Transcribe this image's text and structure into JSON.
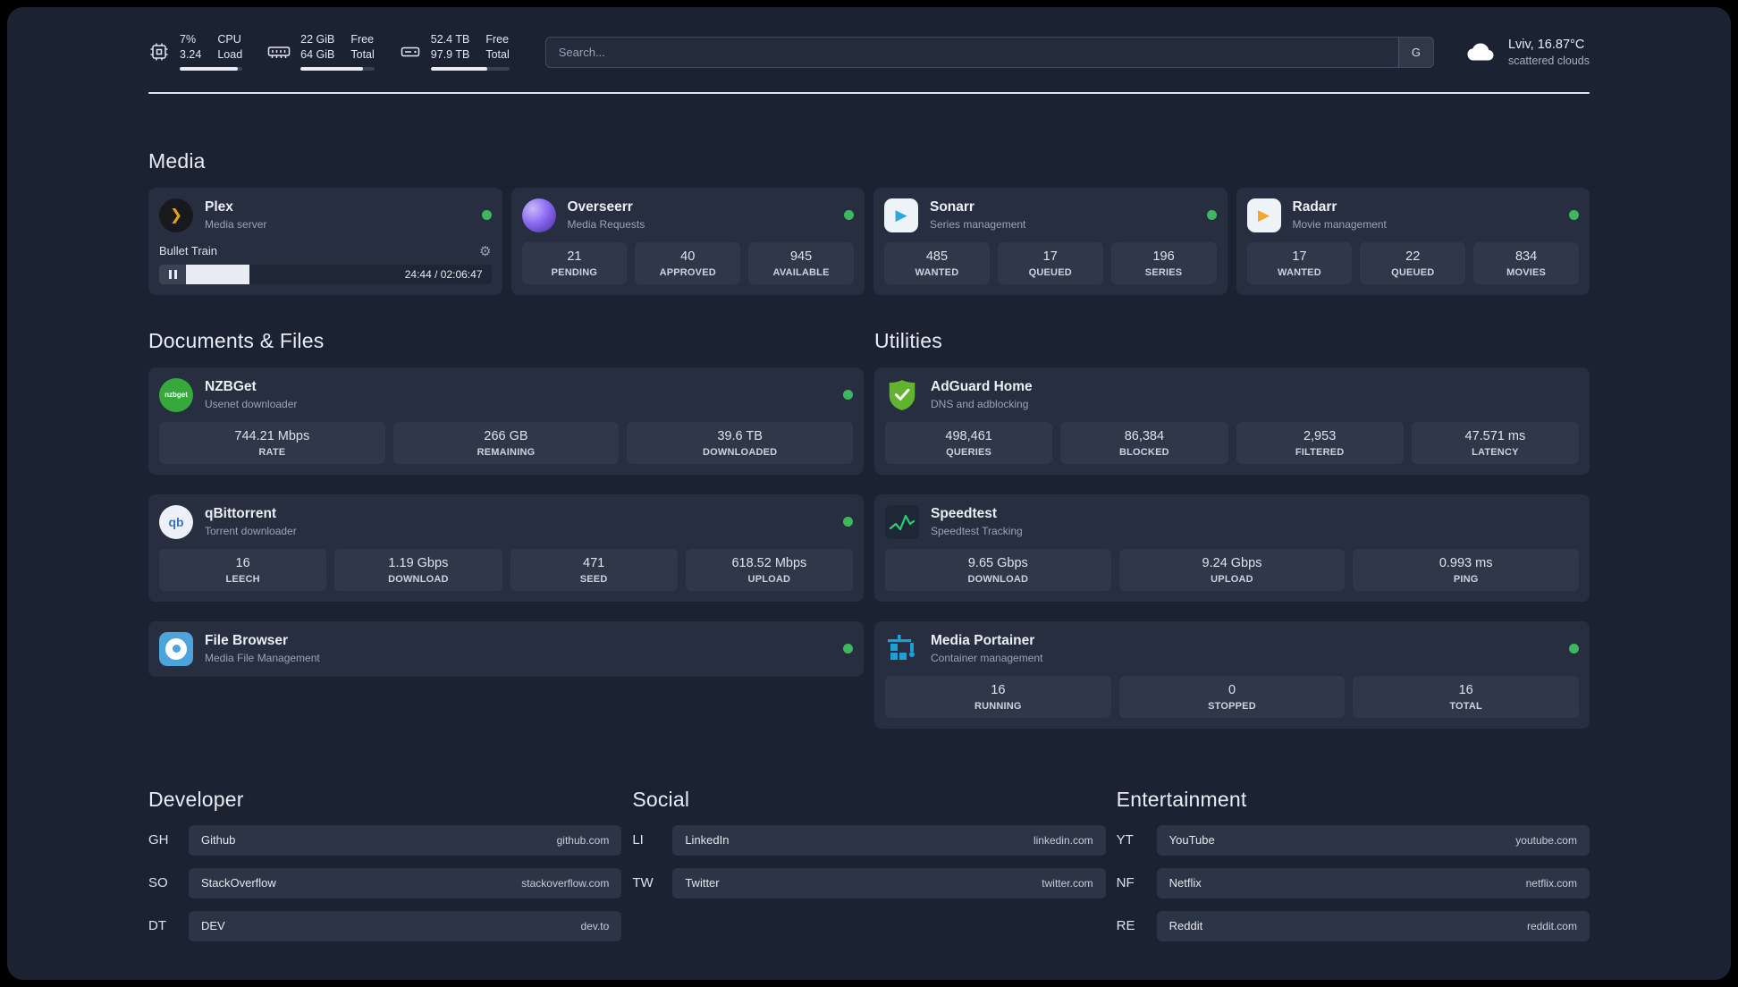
{
  "colors": {
    "status_online": "#3fb75f",
    "plex": "#e5a00d",
    "overseerr": "#8b6cf0",
    "sonarr": "#2da8de",
    "radarr": "#f0a72b",
    "nzbget": "#37a93c",
    "qbittorrent": "#3a74b8",
    "filebrowser": "#4da3dc",
    "adguard": "#62b42f",
    "speedtest": "#2ecc71",
    "portainer": "#1e9fd8"
  },
  "icons": {
    "nzbget_text": "nzbget",
    "qbittorrent_text": "qb"
  },
  "topbar": {
    "cpu": {
      "value_top": "7%",
      "value_bottom": "3.24",
      "label_top": "CPU",
      "label_bottom": "Load",
      "bar_percent": 93
    },
    "ram": {
      "value_top": "22 GiB",
      "value_bottom": "64 GiB",
      "label_top": "Free",
      "label_bottom": "Total",
      "bar_percent": 85
    },
    "disk": {
      "value_top": "52.4 TB",
      "value_bottom": "97.9 TB",
      "label_top": "Free",
      "label_bottom": "Total",
      "bar_percent": 72
    },
    "search": {
      "placeholder": "Search...",
      "engine_button": "G"
    },
    "weather": {
      "location": "Lviv, 16.87°C",
      "condition": "scattered clouds"
    }
  },
  "media": {
    "title": "Media",
    "cards": [
      {
        "name": "Plex",
        "subtitle": "Media server",
        "status": "online",
        "player": {
          "track": "Bullet Train",
          "time": "24:44 / 02:06:47",
          "progress_percent": 19
        }
      },
      {
        "name": "Overseerr",
        "subtitle": "Media Requests",
        "status": "online",
        "stats": [
          {
            "value": "21",
            "label": "PENDING"
          },
          {
            "value": "40",
            "label": "APPROVED"
          },
          {
            "value": "945",
            "label": "AVAILABLE"
          }
        ]
      },
      {
        "name": "Sonarr",
        "subtitle": "Series management",
        "status": "online",
        "stats": [
          {
            "value": "485",
            "label": "WANTED"
          },
          {
            "value": "17",
            "label": "QUEUED"
          },
          {
            "value": "196",
            "label": "SERIES"
          }
        ]
      },
      {
        "name": "Radarr",
        "subtitle": "Movie management",
        "status": "online",
        "stats": [
          {
            "value": "17",
            "label": "WANTED"
          },
          {
            "value": "22",
            "label": "QUEUED"
          },
          {
            "value": "834",
            "label": "MOVIES"
          }
        ]
      }
    ]
  },
  "documents": {
    "title": "Documents & Files",
    "cards": [
      {
        "name": "NZBGet",
        "subtitle": "Usenet downloader",
        "status": "online",
        "stats": [
          {
            "value": "744.21 Mbps",
            "label": "RATE"
          },
          {
            "value": "266 GB",
            "label": "REMAINING"
          },
          {
            "value": "39.6 TB",
            "label": "DOWNLOADED"
          }
        ]
      },
      {
        "name": "qBittorrent",
        "subtitle": "Torrent downloader",
        "status": "online",
        "stats": [
          {
            "value": "16",
            "label": "LEECH"
          },
          {
            "value": "1.19 Gbps",
            "label": "DOWNLOAD"
          },
          {
            "value": "471",
            "label": "SEED"
          },
          {
            "value": "618.52 Mbps",
            "label": "UPLOAD"
          }
        ]
      },
      {
        "name": "File Browser",
        "subtitle": "Media File Management",
        "status": "online",
        "stats": []
      }
    ]
  },
  "utilities": {
    "title": "Utilities",
    "cards": [
      {
        "name": "AdGuard Home",
        "subtitle": "DNS and adblocking",
        "stats": [
          {
            "value": "498,461",
            "label": "QUERIES"
          },
          {
            "value": "86,384",
            "label": "BLOCKED"
          },
          {
            "value": "2,953",
            "label": "FILTERED"
          },
          {
            "value": "47.571 ms",
            "label": "LATENCY"
          }
        ]
      },
      {
        "name": "Speedtest",
        "subtitle": "Speedtest Tracking",
        "stats": [
          {
            "value": "9.65 Gbps",
            "label": "DOWNLOAD"
          },
          {
            "value": "9.24 Gbps",
            "label": "UPLOAD"
          },
          {
            "value": "0.993 ms",
            "label": "PING"
          }
        ]
      },
      {
        "name": "Media Portainer",
        "subtitle": "Container management",
        "status": "online",
        "stats": [
          {
            "value": "16",
            "label": "RUNNING"
          },
          {
            "value": "0",
            "label": "STOPPED"
          },
          {
            "value": "16",
            "label": "TOTAL"
          }
        ]
      }
    ]
  },
  "bookmarks": {
    "groups": [
      {
        "title": "Developer",
        "items": [
          {
            "abbr": "GH",
            "name": "Github",
            "url": "github.com"
          },
          {
            "abbr": "SO",
            "name": "StackOverflow",
            "url": "stackoverflow.com"
          },
          {
            "abbr": "DT",
            "name": "DEV",
            "url": "dev.to"
          }
        ]
      },
      {
        "title": "Social",
        "items": [
          {
            "abbr": "LI",
            "name": "LinkedIn",
            "url": "linkedin.com"
          },
          {
            "abbr": "TW",
            "name": "Twitter",
            "url": "twitter.com"
          }
        ]
      },
      {
        "title": "Entertainment",
        "items": [
          {
            "abbr": "YT",
            "name": "YouTube",
            "url": "youtube.com"
          },
          {
            "abbr": "NF",
            "name": "Netflix",
            "url": "netflix.com"
          },
          {
            "abbr": "RE",
            "name": "Reddit",
            "url": "reddit.com"
          }
        ]
      }
    ]
  }
}
